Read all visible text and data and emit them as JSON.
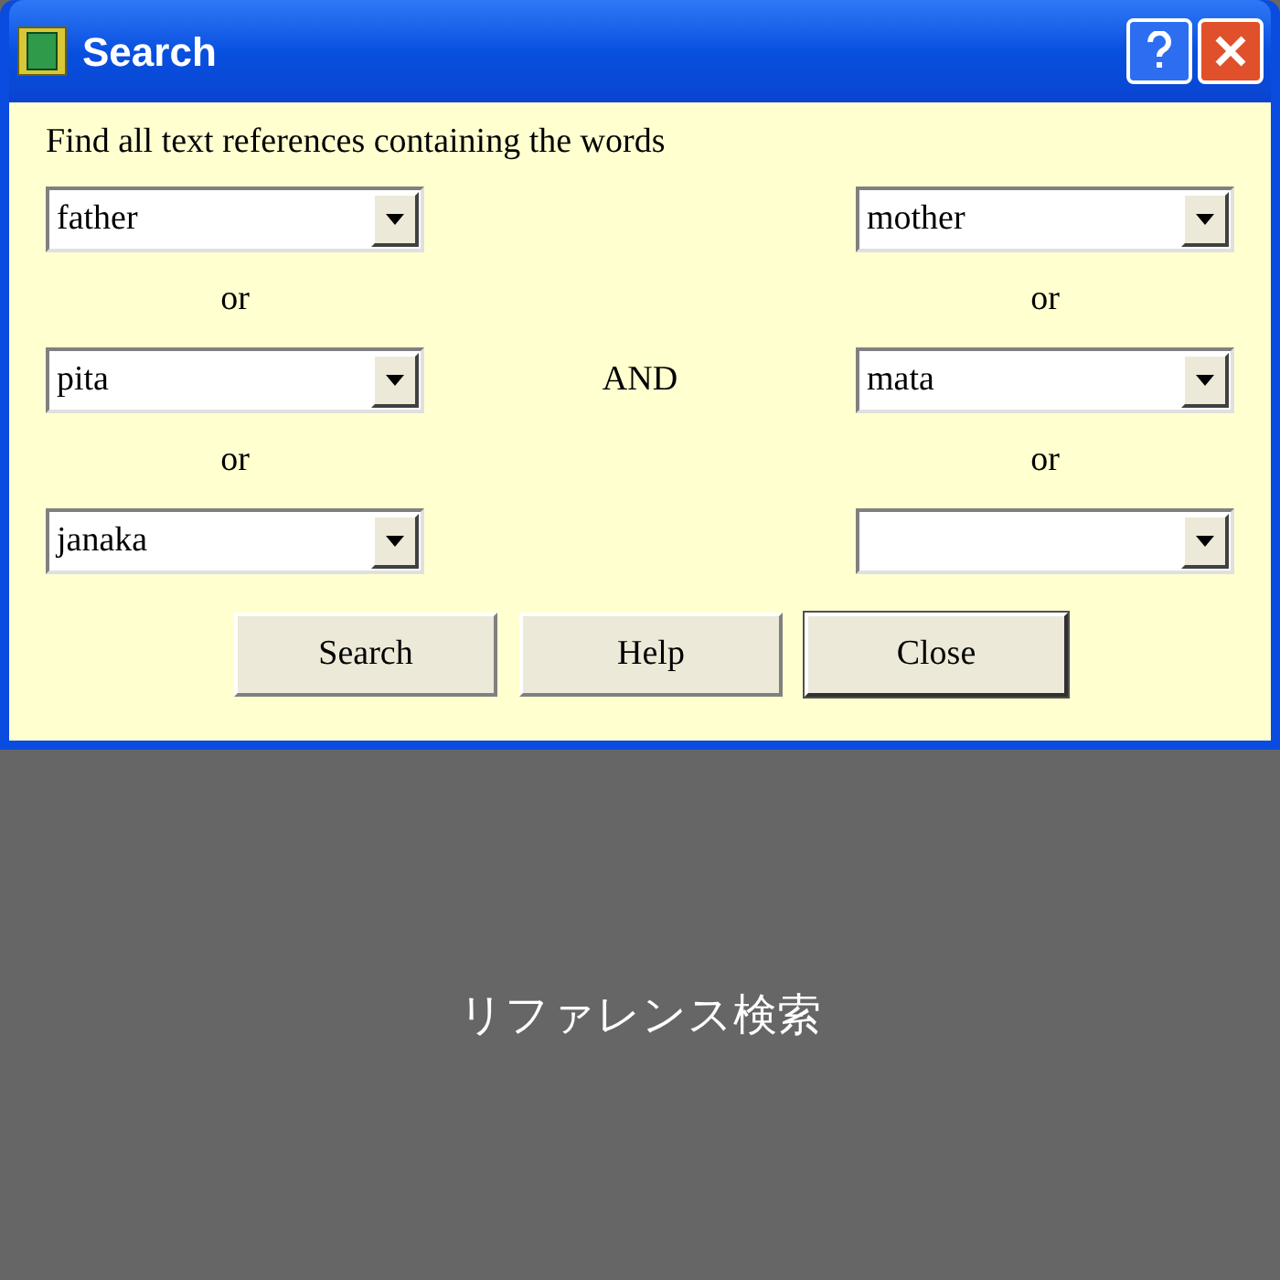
{
  "window": {
    "title": "Search"
  },
  "prompt": "Find all text references containing the words",
  "left": {
    "fields": [
      {
        "kind": "combo",
        "value": "father"
      },
      {
        "kind": "combo",
        "value": "pita"
      },
      {
        "kind": "combo",
        "value": "janaka"
      }
    ],
    "separators": [
      "or",
      "or"
    ]
  },
  "operator": "AND",
  "right": {
    "fields": [
      {
        "kind": "combo",
        "value": "mother"
      },
      {
        "kind": "combo",
        "value": "mata"
      },
      {
        "kind": "combo"
      }
    ],
    "separators": [
      "or",
      "or"
    ]
  },
  "buttons": [
    {
      "label": "Search",
      "default": false
    },
    {
      "label": "Help",
      "default": false
    },
    {
      "label": "Close",
      "default": true
    }
  ],
  "caption": "リファレンス検索"
}
